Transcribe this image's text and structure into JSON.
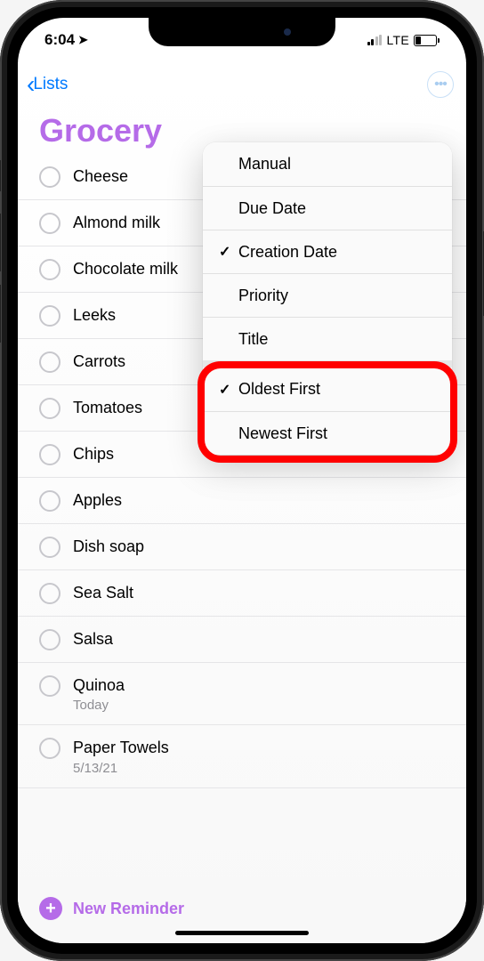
{
  "status": {
    "time": "6:04",
    "network": "LTE"
  },
  "nav": {
    "back_label": "Lists"
  },
  "list": {
    "title": "Grocery",
    "items": [
      {
        "label": "Cheese",
        "sub": null
      },
      {
        "label": "Almond milk",
        "sub": null
      },
      {
        "label": "Chocolate milk",
        "sub": null
      },
      {
        "label": "Leeks",
        "sub": null
      },
      {
        "label": "Carrots",
        "sub": null
      },
      {
        "label": "Tomatoes",
        "sub": null
      },
      {
        "label": "Chips",
        "sub": null
      },
      {
        "label": "Apples",
        "sub": null
      },
      {
        "label": "Dish soap",
        "sub": null
      },
      {
        "label": "Sea Salt",
        "sub": null
      },
      {
        "label": "Salsa",
        "sub": null
      },
      {
        "label": "Quinoa",
        "sub": "Today"
      },
      {
        "label": "Paper Towels",
        "sub": "5/13/21"
      }
    ]
  },
  "footer": {
    "new_reminder_label": "New Reminder"
  },
  "sort_menu": {
    "options": [
      {
        "label": "Manual",
        "checked": false
      },
      {
        "label": "Due Date",
        "checked": false
      },
      {
        "label": "Creation Date",
        "checked": true
      },
      {
        "label": "Priority",
        "checked": false
      },
      {
        "label": "Title",
        "checked": false
      }
    ],
    "direction": [
      {
        "label": "Oldest First",
        "checked": true
      },
      {
        "label": "Newest First",
        "checked": false
      }
    ]
  }
}
